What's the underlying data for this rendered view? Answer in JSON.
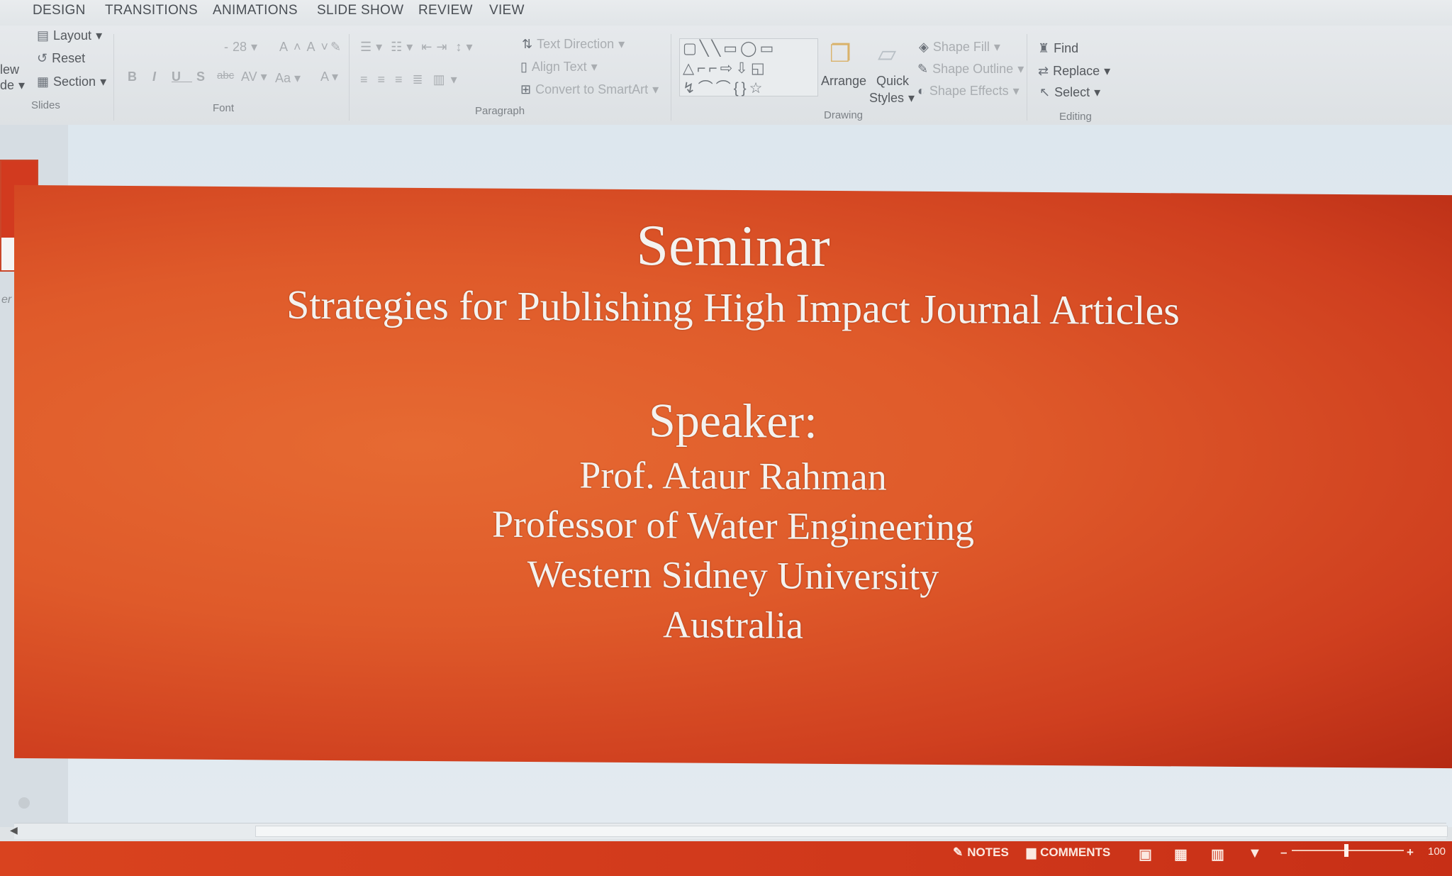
{
  "ribbon_tabs": [
    "DESIGN",
    "TRANSITIONS",
    "ANIMATIONS",
    "SLIDE SHOW",
    "REVIEW",
    "VIEW"
  ],
  "slides_group": {
    "layout": "Layout",
    "reset": "Reset",
    "section": "Section",
    "new_fragment": "lew",
    "slide_fragment": "de",
    "label": "Slides"
  },
  "font_group": {
    "size": "28",
    "label": "Font"
  },
  "paragraph_group": {
    "text_direction": "Text Direction",
    "align_text": "Align Text",
    "convert_smartart": "Convert to SmartArt",
    "label": "Paragraph"
  },
  "drawing_group": {
    "arrange": "Arrange",
    "quick": "Quick",
    "styles": "Styles",
    "shape_fill": "Shape Fill",
    "shape_outline": "Shape Outline",
    "shape_effects": "Shape Effects",
    "label": "Drawing"
  },
  "editing_group": {
    "find": "Find",
    "replace": "Replace",
    "select": "Select",
    "label": "Editing"
  },
  "side_fragment": "er",
  "slide": {
    "title": "Seminar",
    "subtitle": "Strategies for Publishing High Impact Journal Articles",
    "speaker_heading": "Speaker:",
    "speaker_name": "Prof. Ataur Rahman",
    "speaker_role": "Professor of Water Engineering",
    "speaker_org": "Western Sidney University",
    "speaker_country": "Australia"
  },
  "statusbar": {
    "notes": "NOTES",
    "comments": "COMMENTS",
    "zoom": "100"
  },
  "colors": {
    "accent": "#d23a1f",
    "slide_bg": "#df5a2a",
    "slide_text": "#f4f2ef"
  }
}
